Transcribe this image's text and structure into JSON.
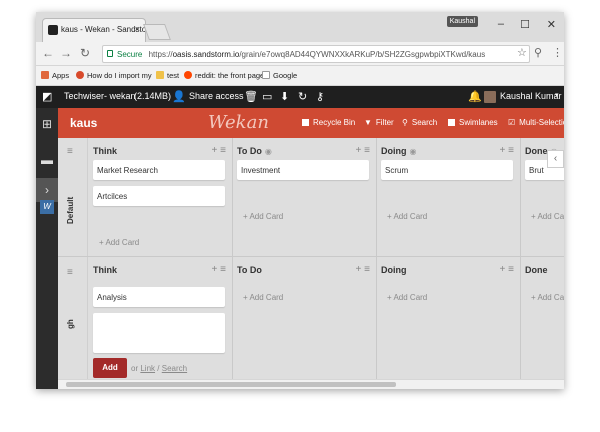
{
  "browser": {
    "tab_title": "kaus - Wekan - Sandstorm",
    "tab_close": "×",
    "profile_name": "Kaushal",
    "window_controls": [
      "–",
      "☐",
      "✕"
    ],
    "secure_label": "Secure",
    "url_scheme": "https://",
    "url_host": "oasis.sandstorm.io",
    "url_path": "/grain/e7owq8AD44QYWNXXkARKuP/b/SH2ZGsgpwbpiXTKwd/kaus",
    "bookmarks": [
      {
        "label": "Apps",
        "color": "#e0683c"
      },
      {
        "label": "How do I import my",
        "color": "#d84a2b"
      },
      {
        "label": "test",
        "color": "#f0c24a"
      },
      {
        "label": "reddit: the front page",
        "color": "#ff4500"
      },
      {
        "label": "Google",
        "color": "#bdbdbd"
      }
    ]
  },
  "sandstorm": {
    "grain_title": "Techwiser- wekan",
    "grain_size": "(2.14MB)",
    "share_access": "Share access",
    "user_name": "Kaushal Kumar"
  },
  "wekan": {
    "board_title": "kaus",
    "logo_text": "Wekan",
    "accent_color": "#cf4a33",
    "header_buttons": {
      "recycle_bin": "Recycle Bin",
      "filter": "Filter",
      "search": "Search",
      "swimlanes": "Swimlanes",
      "multi_selection": "Multi-Selection"
    },
    "add_card_label": "Add Card",
    "swimlanes": [
      {
        "title": "Default",
        "lists": [
          {
            "title": "Think",
            "cards": [
              "Market Research",
              "Artcilces"
            ]
          },
          {
            "title": "To Do",
            "cards": [
              "Investment"
            ]
          },
          {
            "title": "Doing",
            "cards": [
              "Scrum"
            ]
          },
          {
            "title": "Done",
            "cards": [
              "Brut"
            ]
          }
        ]
      },
      {
        "title": "gh",
        "lists": [
          {
            "title": "Think",
            "cards": [
              "Analysis"
            ]
          },
          {
            "title": "To Do",
            "cards": []
          },
          {
            "title": "Doing",
            "cards": []
          },
          {
            "title": "Done",
            "cards": []
          }
        ]
      }
    ],
    "composer": {
      "add_button": "Add",
      "or_text": "or",
      "link_text": "Link",
      "separator": "/",
      "search_text": "Search"
    }
  }
}
